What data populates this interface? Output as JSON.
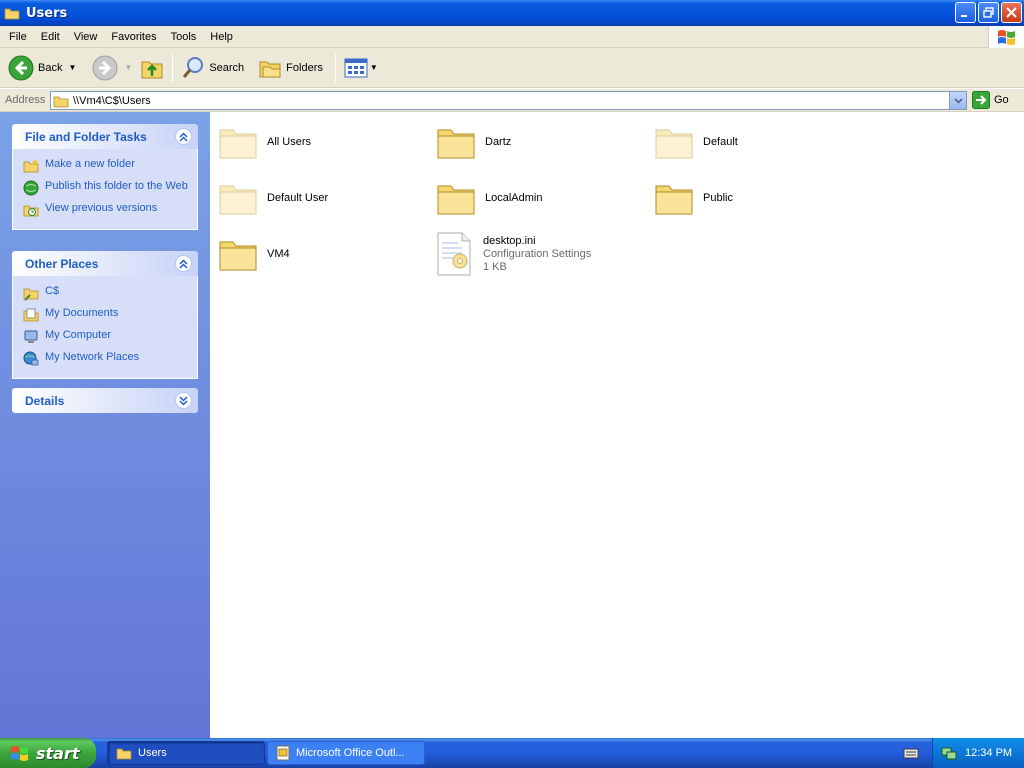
{
  "window": {
    "title": "Users",
    "buttons": [
      "minimize",
      "maximize",
      "close"
    ]
  },
  "menu": {
    "items": [
      "File",
      "Edit",
      "View",
      "Favorites",
      "Tools",
      "Help"
    ]
  },
  "toolbar": {
    "back_label": "Back",
    "search_label": "Search",
    "folders_label": "Folders"
  },
  "address": {
    "label": "Address",
    "value": "\\\\Vm4\\C$\\Users",
    "go_label": "Go"
  },
  "tasks_panel": {
    "title": "File and Folder Tasks",
    "links": [
      "Make a new folder",
      "Publish this folder to the Web",
      "View previous versions"
    ]
  },
  "places_panel": {
    "title": "Other Places",
    "links": [
      "C$",
      "My Documents",
      "My Computer",
      "My Network Places"
    ]
  },
  "details_panel": {
    "title": "Details"
  },
  "items": [
    {
      "name": "All Users",
      "type": "folder",
      "faded": true
    },
    {
      "name": "Dartz",
      "type": "folder",
      "faded": false
    },
    {
      "name": "Default",
      "type": "folder",
      "faded": true
    },
    {
      "name": "Default User",
      "type": "folder",
      "faded": true
    },
    {
      "name": "LocalAdmin",
      "type": "folder",
      "faded": false
    },
    {
      "name": "Public",
      "type": "folder",
      "faded": false
    },
    {
      "name": "VM4",
      "type": "folder",
      "faded": false
    },
    {
      "name": "desktop.ini",
      "type": "file",
      "description": "Configuration Settings",
      "size": "1 KB"
    }
  ],
  "taskbar": {
    "start_label": "start",
    "tasks": [
      "Users",
      "Microsoft Office Outl..."
    ],
    "clock": "12:34 PM"
  },
  "colors": {
    "title_blue": "#0554de",
    "panel_link": "#215dc6",
    "start_green": "#3ca73c",
    "folder_yellow": "#f5d76e"
  }
}
